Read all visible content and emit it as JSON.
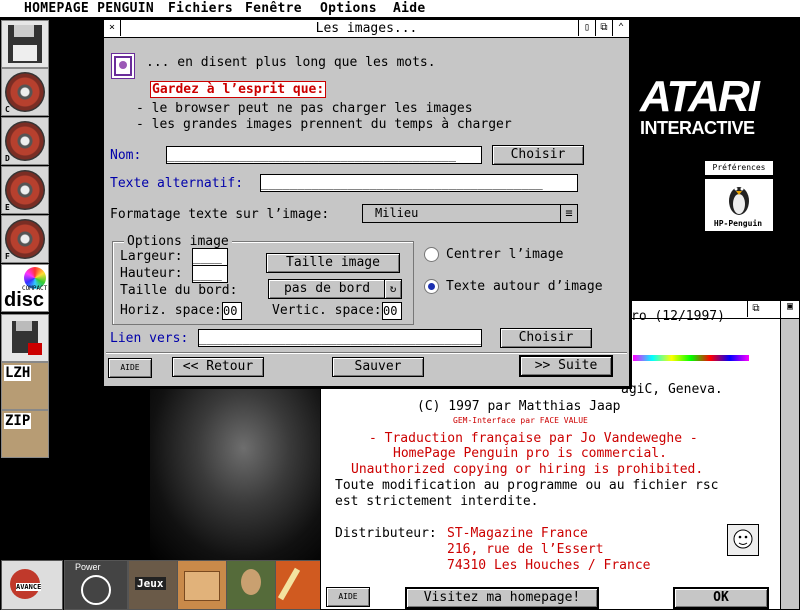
{
  "menubar": {
    "items": [
      "HOMEPAGE PENGUIN",
      "Fichiers",
      "Fenêtre",
      "Options",
      "Aide"
    ]
  },
  "desktop": {
    "left_icons": [
      {
        "label": ""
      },
      {
        "label": "C"
      },
      {
        "label": "D"
      },
      {
        "label": "E"
      },
      {
        "label": "F"
      },
      {
        "label": "disc"
      },
      {
        "label": ""
      },
      {
        "label": "LZH"
      },
      {
        "label": "ZIP"
      }
    ],
    "compact_small": "COMPACT",
    "atari_big": "ATARI",
    "atari_small": "INTERACTIVE",
    "prefs_label": "Préférences",
    "hp_icon_label": "HP-Penguin",
    "dock_power": "Power",
    "dock_jeux": "Jeux",
    "dock_brand": "AVANCE"
  },
  "dialog": {
    "title": "Les images...",
    "intro": "... en disent plus long que les mots.",
    "warn_title": "Gardez à l’esprit que:",
    "bullet1": "- le browser peut ne pas charger les images",
    "bullet2": "- les grandes images prennent du temps à charger",
    "name_label": "Nom:",
    "name_value": "________________________________________",
    "choose": "Choisir",
    "alt_label": "Texte alternatif:",
    "alt_value": "_______________________________________",
    "format_label": "Formatage texte sur l’image:",
    "format_value": "Milieu",
    "options_title": "Options image",
    "width_label": "Largeur:",
    "width_value": "____",
    "height_label": "Hauteur:",
    "height_value": "____",
    "border_label": "Taille du bord:",
    "size_btn": "Taille image",
    "no_border": "pas de bord",
    "hspace_label": "Horiz. space:",
    "hspace_value": "00",
    "vspace_label": "Vertic. space:",
    "vspace_value": "00",
    "center_label": "Centrer l’image",
    "wrap_label": "Texte autour d’image",
    "link_label": "Lien vers:",
    "link_value": "________________________________________",
    "choose2": "Choisir",
    "help": "AIDE",
    "back": "<< Retour",
    "save": "Sauver",
    "next": ">> Suite"
  },
  "about": {
    "line_top": "ro (12/1997)",
    "line_magic": "agiC, Geneva.",
    "copyright": "(C) 1997 par Matthias Jaap",
    "gem": "GEM-Interface par FACE VALUE",
    "trad": "- Traduction française par Jo Vandeweghe -",
    "commercial": "HomePage Penguin pro is commercial.",
    "unauth": "Unauthorized copying or hiring is prohibited.",
    "mod1": "Toute modification au programme ou au fichier rsc",
    "mod2": "est strictement interdite.",
    "dist_label": "Distributeur:",
    "dist1": "ST-Magazine France",
    "dist2": "216, rue de l’Essert",
    "dist3": "74310 Les Houches / France",
    "help": "AIDE",
    "visit": "Visitez ma homepage!",
    "ok": "OK"
  }
}
